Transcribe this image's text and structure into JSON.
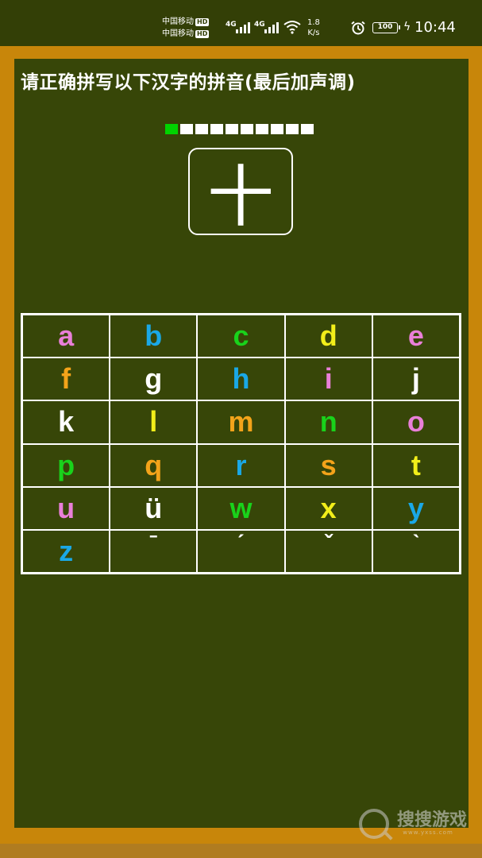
{
  "status_bar": {
    "carrier_1": "中国移动",
    "carrier_2": "中国移动",
    "hd_badge": "HD",
    "net_1": "4G",
    "net_2": "4G",
    "speed_value": "1.8",
    "speed_unit": "K/s",
    "battery": "100",
    "time": "10:44"
  },
  "instruction": "请正确拼写以下汉字的拼音(最后加声调)",
  "progress": {
    "current": 1,
    "total": 10,
    "done_color": "#00d400"
  },
  "character": "十",
  "keys": [
    {
      "label": "a",
      "color": "#e97fd8"
    },
    {
      "label": "b",
      "color": "#1aa8e6"
    },
    {
      "label": "c",
      "color": "#19d21b"
    },
    {
      "label": "d",
      "color": "#f2ee1a"
    },
    {
      "label": "e",
      "color": "#e97fd8"
    },
    {
      "label": "f",
      "color": "#f3a31a"
    },
    {
      "label": "g",
      "color": "#ffffff"
    },
    {
      "label": "h",
      "color": "#1aa8e6"
    },
    {
      "label": "i",
      "color": "#e97fd8"
    },
    {
      "label": "j",
      "color": "#ffffff"
    },
    {
      "label": "k",
      "color": "#ffffff"
    },
    {
      "label": "l",
      "color": "#f2ee1a"
    },
    {
      "label": "m",
      "color": "#f3a31a"
    },
    {
      "label": "n",
      "color": "#19d21b"
    },
    {
      "label": "o",
      "color": "#e97fd8"
    },
    {
      "label": "p",
      "color": "#19d21b"
    },
    {
      "label": "q",
      "color": "#f3a31a"
    },
    {
      "label": "r",
      "color": "#1aa8e6"
    },
    {
      "label": "s",
      "color": "#f3a31a"
    },
    {
      "label": "t",
      "color": "#f2ee1a"
    },
    {
      "label": "u",
      "color": "#e97fd8"
    },
    {
      "label": "ü",
      "color": "#ffffff"
    },
    {
      "label": "w",
      "color": "#19d21b"
    },
    {
      "label": "x",
      "color": "#f2ee1a"
    },
    {
      "label": "y",
      "color": "#1aa8e6"
    },
    {
      "label": "z",
      "color": "#1aa8e6"
    },
    {
      "label": "ˉ",
      "color": "#ffffff"
    },
    {
      "label": "ˊ",
      "color": "#ffffff"
    },
    {
      "label": "ˇ",
      "color": "#ffffff"
    },
    {
      "label": "ˋ",
      "color": "#ffffff"
    }
  ],
  "watermark": {
    "text": "搜搜游戏",
    "url": "www.yxss.com"
  }
}
